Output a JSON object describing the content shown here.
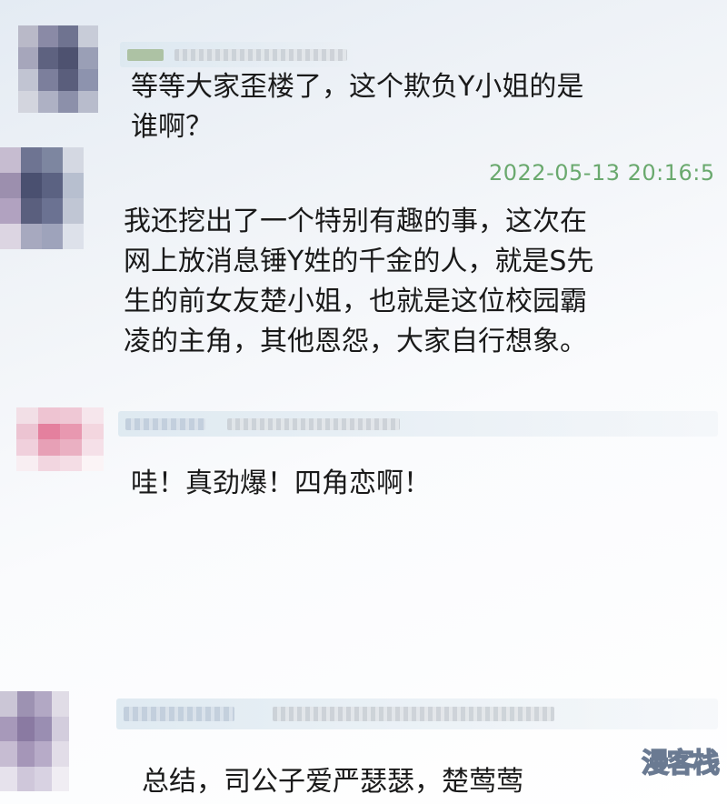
{
  "comments": [
    {
      "text": "等等大家歪楼了，这个欺负Y小姐的是\n谁啊？",
      "timestamp": ""
    },
    {
      "text": "我还挖出了一个特别有趣的事，这次在\n网上放消息锤Y姓的千金的人，就是S先\n生的前女友楚小姐，也就是这位校园霸\n凌的主角，其他恩怨，大家自行想象。",
      "timestamp": "2022-05-13 20:16:5"
    },
    {
      "text": "哇！真劲爆！四角恋啊！",
      "timestamp": ""
    },
    {
      "text": "总结，司公子爱严瑟瑟，楚莺莺",
      "timestamp": ""
    }
  ],
  "watermark": "漫客栈",
  "colors": {
    "timestamp": "#6aa96e",
    "text": "#1a1a1a"
  }
}
